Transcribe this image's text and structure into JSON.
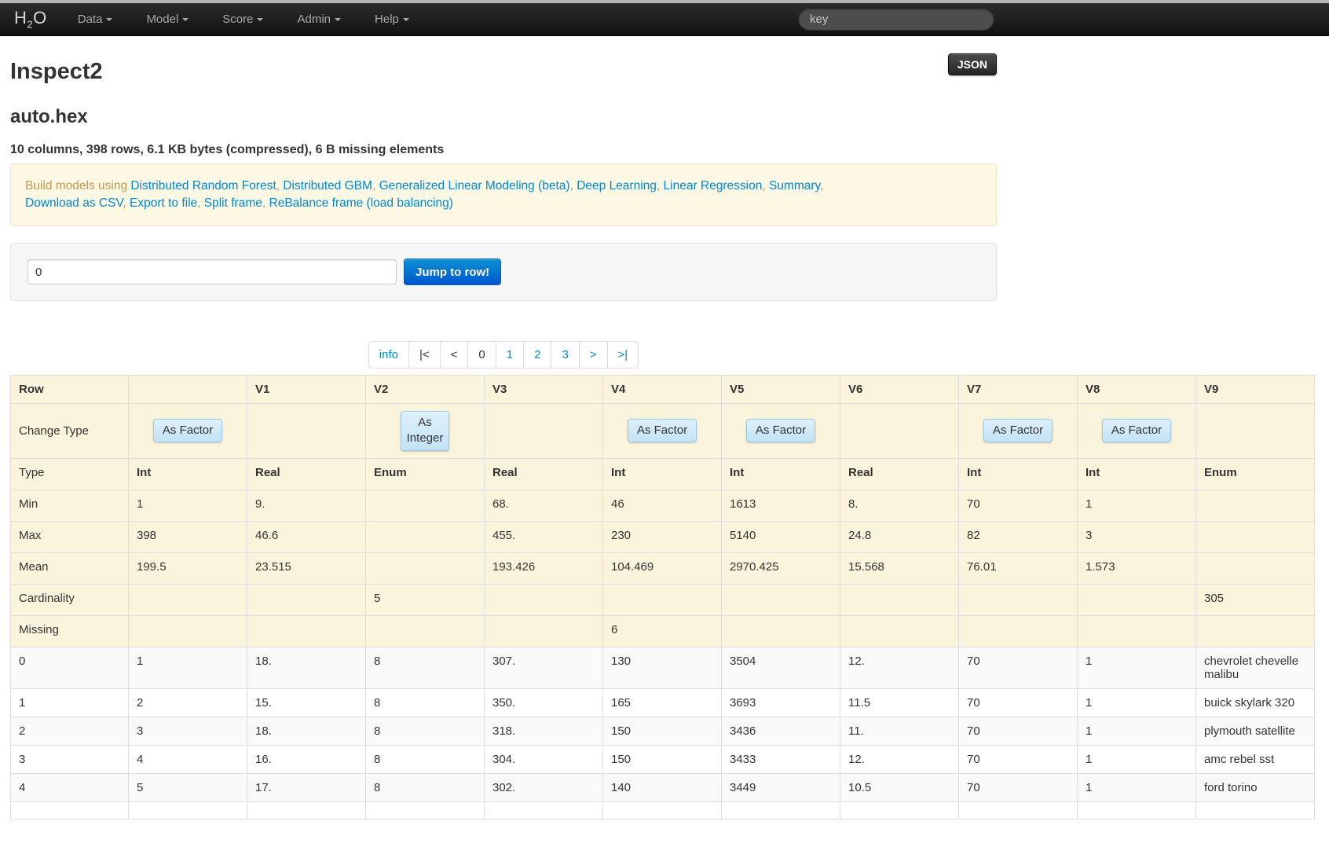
{
  "colors": {
    "accent_blue": "#0088cc",
    "navbar_bg": "#1b1b1b",
    "cream_row": "#fbf4dc",
    "change_btn_bg": "#c3e3f4",
    "primary_btn": "#0055cc",
    "alert_bg": "#fcf8e3",
    "alert_text": "#c09853"
  },
  "navbar": {
    "brand_main": "H",
    "brand_sub": "2",
    "brand_end": "O",
    "items": [
      {
        "label": "Data"
      },
      {
        "label": "Model"
      },
      {
        "label": "Score"
      },
      {
        "label": "Admin"
      },
      {
        "label": "Help"
      }
    ],
    "search_placeholder": "key"
  },
  "page": {
    "title": "Inspect2",
    "json_button_label": "JSON",
    "frame_name": "auto.hex",
    "frame_summary": "10 columns, 398 rows, 6.1 KB bytes (compressed), 6 B missing elements"
  },
  "build_bar": {
    "prefix": "Build models using ",
    "separator": ", ",
    "links": [
      "Distributed Random Forest",
      "Distributed GBM",
      "Generalized Linear Modeling (beta)",
      "Deep Learning",
      "Linear Regression",
      "Summary",
      "Download as CSV",
      "Export to file",
      "Split frame",
      "ReBalance frame (load balancing)"
    ]
  },
  "jump_row": {
    "input_value": "0",
    "button_label": "Jump to row!"
  },
  "pagination": {
    "items": [
      {
        "label": "info",
        "name": "info",
        "state": "link"
      },
      {
        "label": "|<",
        "name": "first",
        "state": "disabled"
      },
      {
        "label": "<",
        "name": "prev",
        "state": "disabled"
      },
      {
        "label": "0",
        "name": "page-0",
        "state": "current"
      },
      {
        "label": "1",
        "name": "page-1",
        "state": "link"
      },
      {
        "label": "2",
        "name": "page-2",
        "state": "link"
      },
      {
        "label": "3",
        "name": "page-3",
        "state": "link"
      },
      {
        "label": ">",
        "name": "next",
        "state": "link"
      },
      {
        "label": ">|",
        "name": "last",
        "state": "link"
      }
    ]
  },
  "table": {
    "header": [
      "Row",
      "",
      "V1",
      "V2",
      "V3",
      "V4",
      "V5",
      "V6",
      "V7",
      "V8",
      "V9"
    ],
    "change_type_row": {
      "label": "Change Type",
      "buttons": [
        "As Factor",
        "",
        "As Integer",
        "",
        "As Factor",
        "As Factor",
        "",
        "As Factor",
        "As Factor",
        ""
      ]
    },
    "stat_rows": [
      {
        "label": "Type",
        "bold": true,
        "values": [
          "Int",
          "Real",
          "Enum",
          "Real",
          "Int",
          "Int",
          "Real",
          "Int",
          "Int",
          "Enum"
        ]
      },
      {
        "label": "Min",
        "values": [
          "1",
          "9.",
          "",
          "68.",
          "46",
          "1613",
          "8.",
          "70",
          "1",
          ""
        ]
      },
      {
        "label": "Max",
        "values": [
          "398",
          "46.6",
          "",
          "455.",
          "230",
          "5140",
          "24.8",
          "82",
          "3",
          ""
        ]
      },
      {
        "label": "Mean",
        "values": [
          "199.5",
          "23.515",
          "",
          "193.426",
          "104.469",
          "2970.425",
          "15.568",
          "76.01",
          "1.573",
          ""
        ]
      },
      {
        "label": "Cardinality",
        "values": [
          "",
          "",
          "5",
          "",
          "",
          "",
          "",
          "",
          "",
          "305"
        ]
      },
      {
        "label": "Missing",
        "values": [
          "",
          "",
          "",
          "",
          "6",
          "",
          "",
          "",
          "",
          ""
        ]
      }
    ],
    "data_rows": [
      [
        "0",
        "1",
        "18.",
        "8",
        "307.",
        "130",
        "3504",
        "12.",
        "70",
        "1",
        "chevrolet chevelle malibu"
      ],
      [
        "1",
        "2",
        "15.",
        "8",
        "350.",
        "165",
        "3693",
        "11.5",
        "70",
        "1",
        "buick skylark 320"
      ],
      [
        "2",
        "3",
        "18.",
        "8",
        "318.",
        "150",
        "3436",
        "11.",
        "70",
        "1",
        "plymouth satellite"
      ],
      [
        "3",
        "4",
        "16.",
        "8",
        "304.",
        "150",
        "3433",
        "12.",
        "70",
        "1",
        "amc rebel sst"
      ],
      [
        "4",
        "5",
        "17.",
        "8",
        "302.",
        "140",
        "3449",
        "10.5",
        "70",
        "1",
        "ford torino"
      ]
    ]
  }
}
